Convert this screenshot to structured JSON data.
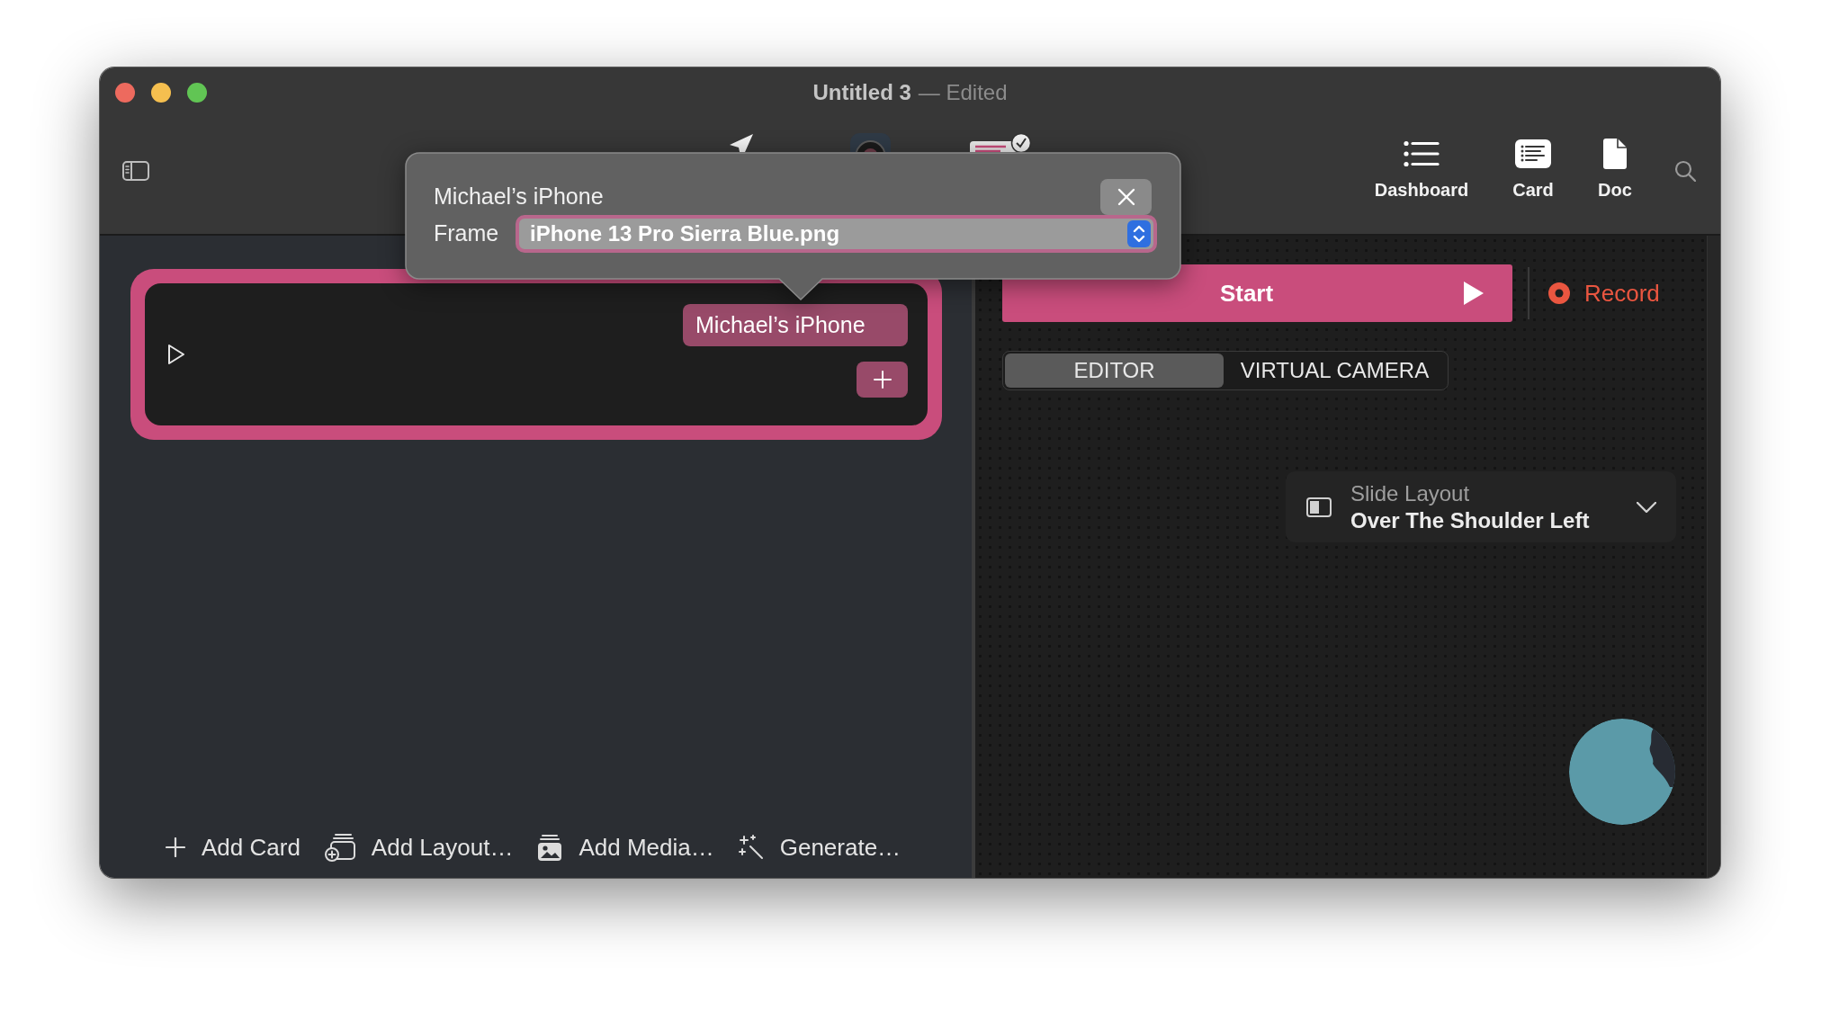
{
  "window": {
    "title": "Untitled 3",
    "edited_note": "— Edited"
  },
  "toolbar": {
    "items": [
      {
        "kind": "dashboard",
        "label": "Dashboard"
      },
      {
        "kind": "card",
        "label": "Card"
      },
      {
        "kind": "doc",
        "label": "Doc"
      }
    ]
  },
  "popover": {
    "title": "Michael’s iPhone",
    "field_label": "Frame",
    "frame_select": {
      "value": "iPhone 13 Pro Sierra Blue.png",
      "focused": true
    }
  },
  "card": {
    "selected": true,
    "device_tag": "Michael’s iPhone"
  },
  "bottom_bar": [
    {
      "kind": "add",
      "label": "Add Card"
    },
    {
      "kind": "layout",
      "label": "Add Layout…"
    },
    {
      "kind": "media",
      "label": "Add Media…"
    },
    {
      "kind": "generate",
      "label": "Generate…"
    }
  ],
  "start_button": {
    "label": "Start"
  },
  "record_button": {
    "label": "Record"
  },
  "mode_tabs": [
    {
      "label": "EDITOR",
      "selected": true
    },
    {
      "label": "VIRTUAL CAMERA",
      "selected": false
    }
  ],
  "slide_layout": {
    "label": "Slide Layout",
    "value": "Over The Shoulder Left"
  }
}
